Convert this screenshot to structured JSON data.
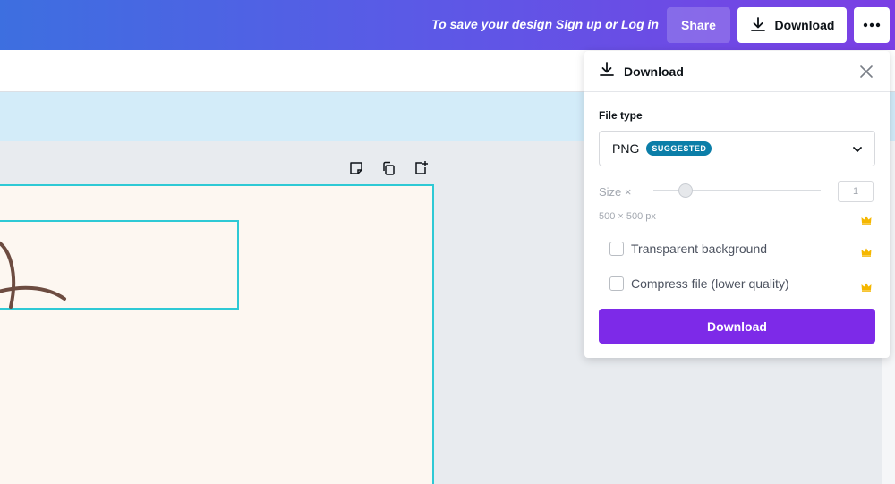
{
  "header": {
    "save_prefix": "To save your design ",
    "signup_link": "Sign up",
    "or_text": " or ",
    "login_link": "Log in",
    "share_label": "Share",
    "download_label": "Download",
    "more_icon": "more-dots-icon",
    "gradient_start": "#3d6fe0",
    "gradient_end": "#7b3fe4"
  },
  "download_panel": {
    "title": "Download",
    "file_type_label": "File type",
    "file_type_value": "PNG",
    "suggested_badge": "SUGGESTED",
    "size_label": "Size ×",
    "size_value": "1",
    "dimensions": "500 × 500 px",
    "options": [
      {
        "label": "Transparent background",
        "checked": false,
        "premium": true
      },
      {
        "label": "Compress file (lower quality)",
        "checked": false,
        "premium": true
      }
    ],
    "download_button": "Download",
    "accent_color": "#7d2ae8",
    "badge_color": "#0b7ea8",
    "premium_icon": "crown-icon"
  },
  "canvas": {
    "page_actions": [
      "note-icon",
      "duplicate-icon",
      "add-page-icon"
    ]
  }
}
